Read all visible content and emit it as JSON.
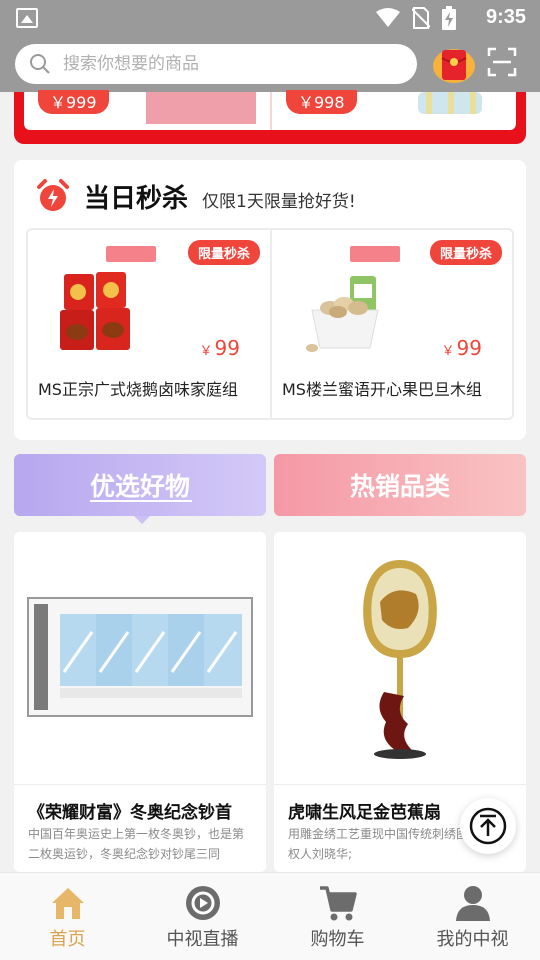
{
  "status_bar": {
    "time": "9:35"
  },
  "search": {
    "placeholder": "搜索你想要的商品"
  },
  "top_products": [
    {
      "price": "￥999"
    },
    {
      "price": "￥998"
    }
  ],
  "flash_sale": {
    "title": "当日秒杀",
    "subtitle": "仅限1天限量抢好货!",
    "items": [
      {
        "badge": "限量秒杀",
        "currency": "￥",
        "price": "99",
        "name": "MS正宗广式烧鹅卤味家庭组"
      },
      {
        "badge": "限量秒杀",
        "currency": "￥",
        "price": "99",
        "name": "MS楼兰蜜语开心果巴旦木组"
      }
    ]
  },
  "tabs": [
    {
      "label": "优选好物",
      "active": true
    },
    {
      "label": "热销品类",
      "active": false
    }
  ],
  "products": [
    {
      "title": "《荣耀财富》冬奥纪念钞首",
      "desc": "中国百年奥运史上第一枚冬奥钞，也是第二枚奥运钞，冬奥纪念钞对钞尾三同"
    },
    {
      "title": "虎啸生风足金芭蕉扇",
      "desc": "用雕金绣工艺重现中国传统刺绣图案著作权人刘晓华;"
    }
  ],
  "bottom_nav": [
    {
      "label": "首页",
      "icon": "home-icon",
      "active": true
    },
    {
      "label": "中视直播",
      "icon": "live-play-icon",
      "active": false
    },
    {
      "label": "购物车",
      "icon": "cart-icon",
      "active": false
    },
    {
      "label": "我的中视",
      "icon": "user-icon",
      "active": false
    }
  ],
  "colors": {
    "accent_red": "#f0453b",
    "nav_active": "#d9a34e",
    "tab_purple": "#b7a7ef",
    "tab_pink": "#f598a6"
  }
}
